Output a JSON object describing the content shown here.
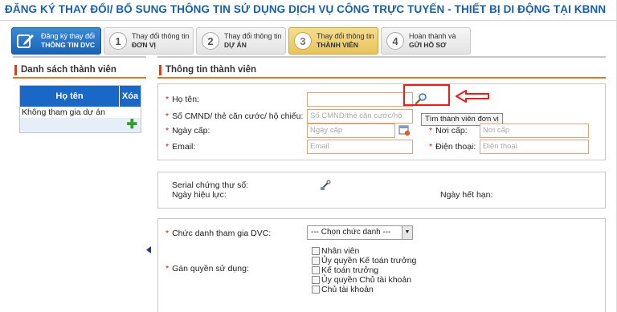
{
  "header": {
    "title": "ĐĂNG KÝ THAY ĐỔI/ BỔ SUNG THÔNG TIN SỬ DỤNG DỊCH VỤ CÔNG TRỰC TUYẾN - THIẾT BỊ DI ĐỘNG TẠI KBNN"
  },
  "steps": [
    {
      "num": "",
      "line1": "Đăng ký thay đổi",
      "line2": "THÔNG TIN DVC",
      "icon": "edit-icon"
    },
    {
      "num": "1",
      "line1": "Thay đổi thông tin",
      "line2": "ĐƠN VỊ"
    },
    {
      "num": "2",
      "line1": "Thay đổi thông tin",
      "line2": "DỰ ÁN"
    },
    {
      "num": "3",
      "line1": "Thay đổi thông tin",
      "line2": "THÀNH VIÊN"
    },
    {
      "num": "4",
      "line1": "Hoàn thành và",
      "line2": "GỬI HỒ SƠ"
    }
  ],
  "members": {
    "heading": "Danh sách thành viên",
    "col_name": "Họ tên",
    "col_delete": "Xóa",
    "rows": [
      "Không tham gia dự án"
    ],
    "add_icon": "plus-icon"
  },
  "info": {
    "heading": "Thông tin thành viên",
    "ho_ten": {
      "label": "Họ tên:",
      "value": ""
    },
    "cmnd": {
      "label": "Số CMND/ thẻ căn cước/ hộ chiếu:",
      "placeholder": "Số CMND/thẻ căn cước/hộ chiếu"
    },
    "ngay_cap": {
      "label": "Ngày cấp:",
      "placeholder": "Ngày cấp"
    },
    "noi_cap": {
      "label": "Nơi cấp:",
      "placeholder": "Nơi cấp"
    },
    "email": {
      "label": "Email:",
      "placeholder": "Email"
    },
    "dien_thoai": {
      "label": "Điện thoại:",
      "placeholder": "Điện thoại"
    },
    "tooltip": "Tìm thành viên đơn vị"
  },
  "cert": {
    "serial_label": "Serial chứng thư số:",
    "hieu_luc_label": "Ngày hiệu lực:",
    "het_han_label": "Ngày hết hạn:"
  },
  "role": {
    "label": "Chức danh tham gia DVC:",
    "select_value": "--- Chọn chức danh ---",
    "perm_label": "Gán quyền sử dụng:",
    "options": [
      "Nhân viên",
      "Ủy quyền Kế toán trưởng",
      "Kế toán trưởng",
      "Ủy quyền Chủ tài khoản",
      "Chủ tài khoản"
    ]
  },
  "colors": {
    "accent": "#1a5fa8",
    "required": "#d11111",
    "highlight": "#e3201c"
  }
}
